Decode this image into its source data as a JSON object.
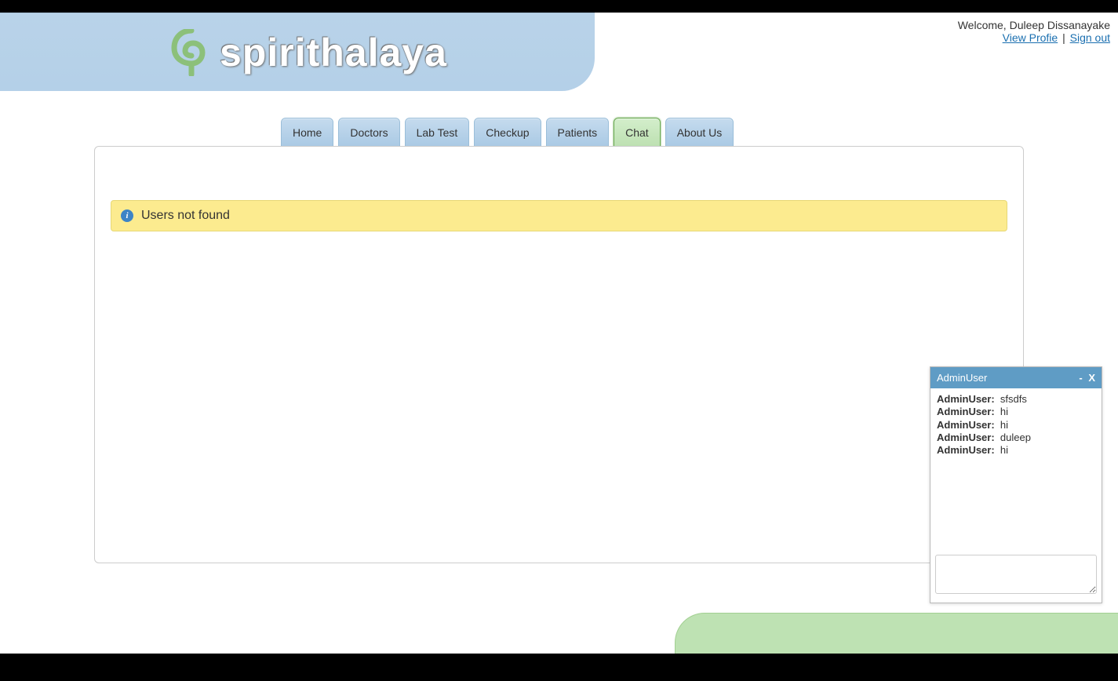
{
  "brand": {
    "name": "spirithalaya"
  },
  "user": {
    "welcome_prefix": "Welcome, ",
    "name": "Duleep Dissanayake",
    "view_profile_label": "View Profie",
    "separator": " | ",
    "signout_label": "Sign out"
  },
  "nav": {
    "items": [
      {
        "label": "Home",
        "active": false
      },
      {
        "label": "Doctors",
        "active": false
      },
      {
        "label": "Lab Test",
        "active": false
      },
      {
        "label": "Checkup",
        "active": false
      },
      {
        "label": "Patients",
        "active": false
      },
      {
        "label": "Chat",
        "active": true
      },
      {
        "label": "About Us",
        "active": false
      }
    ]
  },
  "alert": {
    "message": "Users not found"
  },
  "chat": {
    "title": "AdminUser",
    "minimize": "-",
    "close": "X",
    "messages": [
      {
        "sender": "AdminUser:",
        "text": "sfsdfs"
      },
      {
        "sender": "AdminUser:",
        "text": "hi"
      },
      {
        "sender": "AdminUser:",
        "text": "hi"
      },
      {
        "sender": "AdminUser:",
        "text": "duleep"
      },
      {
        "sender": "AdminUser:",
        "text": "hi"
      }
    ],
    "input_value": ""
  }
}
